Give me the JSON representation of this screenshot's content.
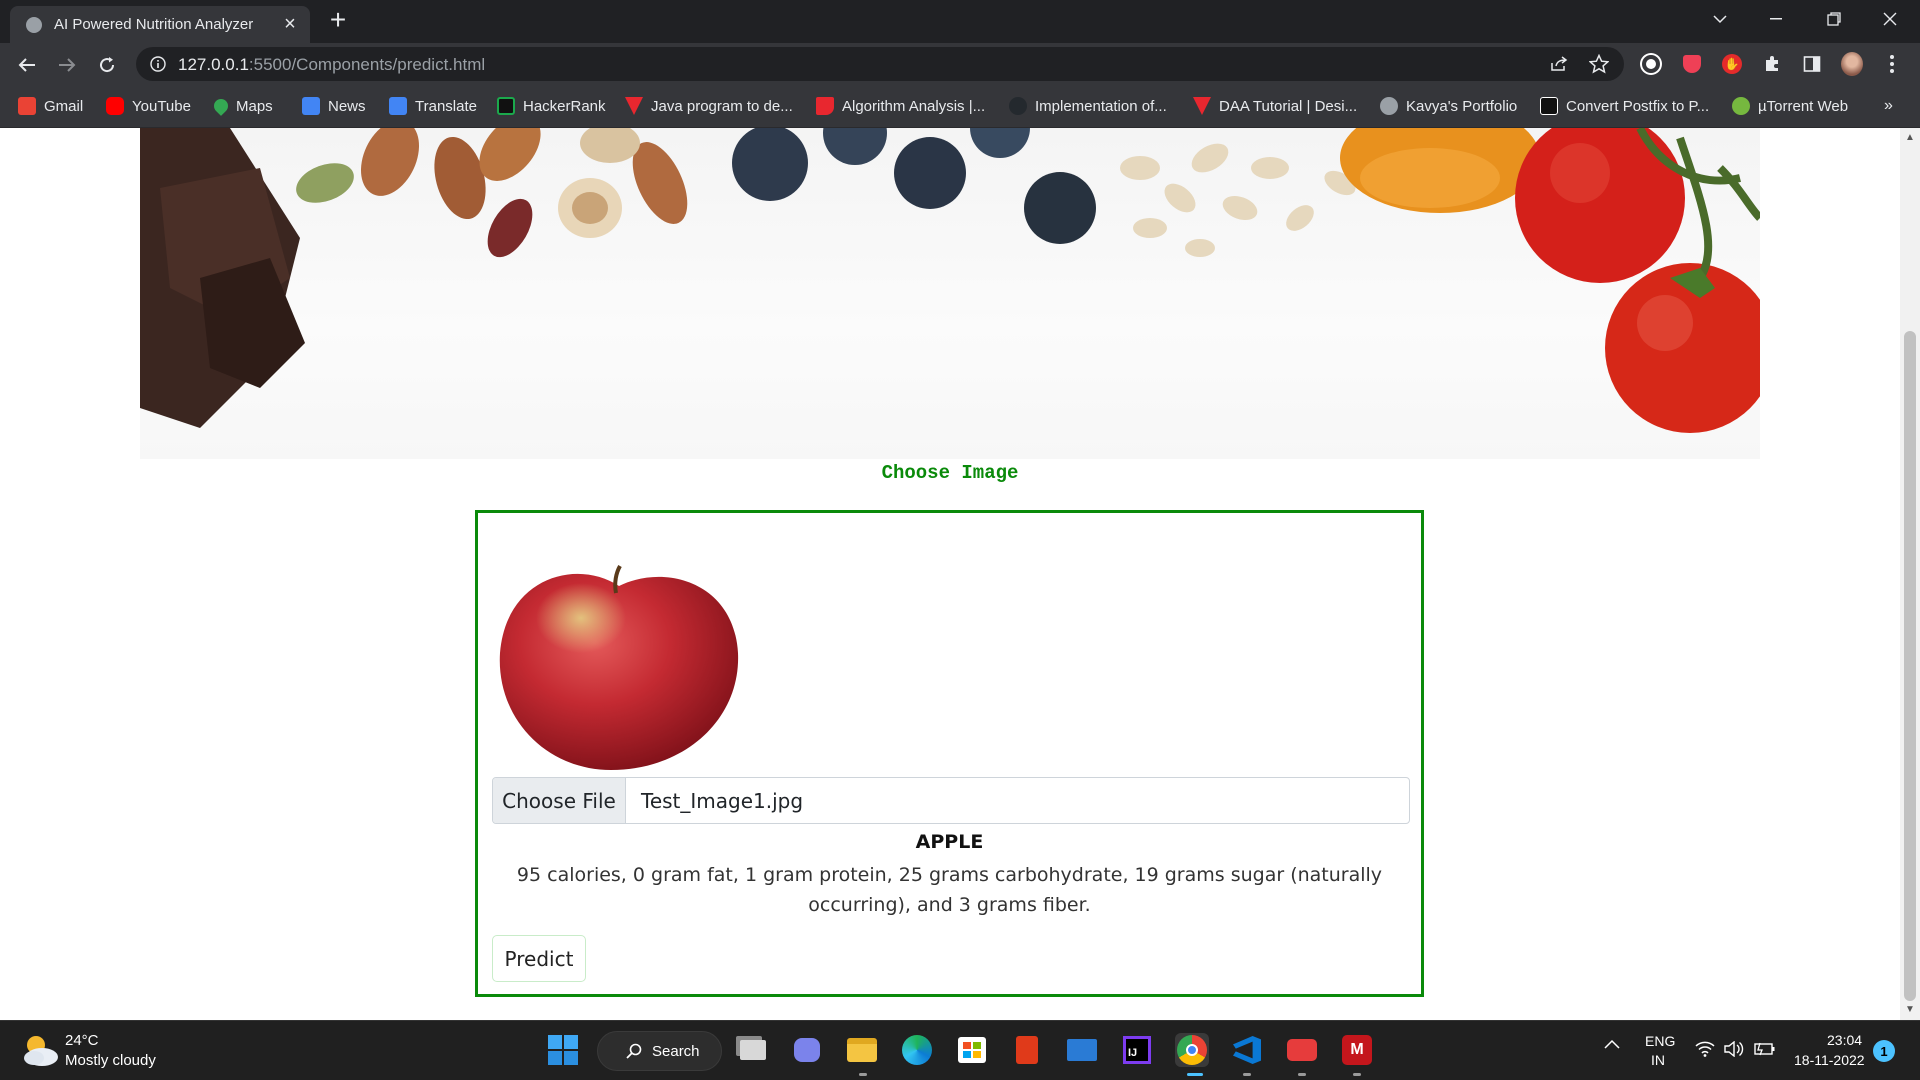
{
  "tab": {
    "title": "AI Powered Nutrition Analyzer"
  },
  "address": {
    "host": "127.0.0.1",
    "path": ":5500/Components/predict.html"
  },
  "bookmarks": [
    {
      "label": "Gmail",
      "color": "#ea4335"
    },
    {
      "label": "YouTube",
      "color": "#ff0000"
    },
    {
      "label": "Maps",
      "color": "#34a853"
    },
    {
      "label": "News",
      "color": "#4285f4"
    },
    {
      "label": "Translate",
      "color": "#4285f4"
    },
    {
      "label": "HackerRank",
      "color": "#1ba94c"
    },
    {
      "label": "Java program to de...",
      "color": "#e8272f"
    },
    {
      "label": "Algorithm Analysis |...",
      "color": "#e8272f"
    },
    {
      "label": "Implementation of...",
      "color": "#24292e"
    },
    {
      "label": "DAA Tutorial | Desi...",
      "color": "#e8272f"
    },
    {
      "label": "Kavya's Portfolio",
      "color": "#9aa0a6"
    },
    {
      "label": "Convert Postfix to P...",
      "color": "#111111"
    },
    {
      "label": "µTorrent Web",
      "color": "#76b83f"
    }
  ],
  "page": {
    "choose_heading": "Choose Image",
    "file_button": "Choose File",
    "file_name": "Test_Image1.jpg",
    "result_label": "APPLE",
    "result_description": "95 calories, 0 gram fat, 1 gram protein, 25 grams carbohydrate, 19 grams sugar (naturally occurring), and 3 grams fiber.",
    "predict_button": "Predict",
    "accent_color": "#0a8a0a"
  },
  "taskbar": {
    "weather_temp": "24°C",
    "weather_desc": "Mostly cloudy",
    "search_label": "Search",
    "lang_line1": "ENG",
    "lang_line2": "IN",
    "time": "23:04",
    "date": "18-11-2022",
    "notification_count": "1"
  }
}
